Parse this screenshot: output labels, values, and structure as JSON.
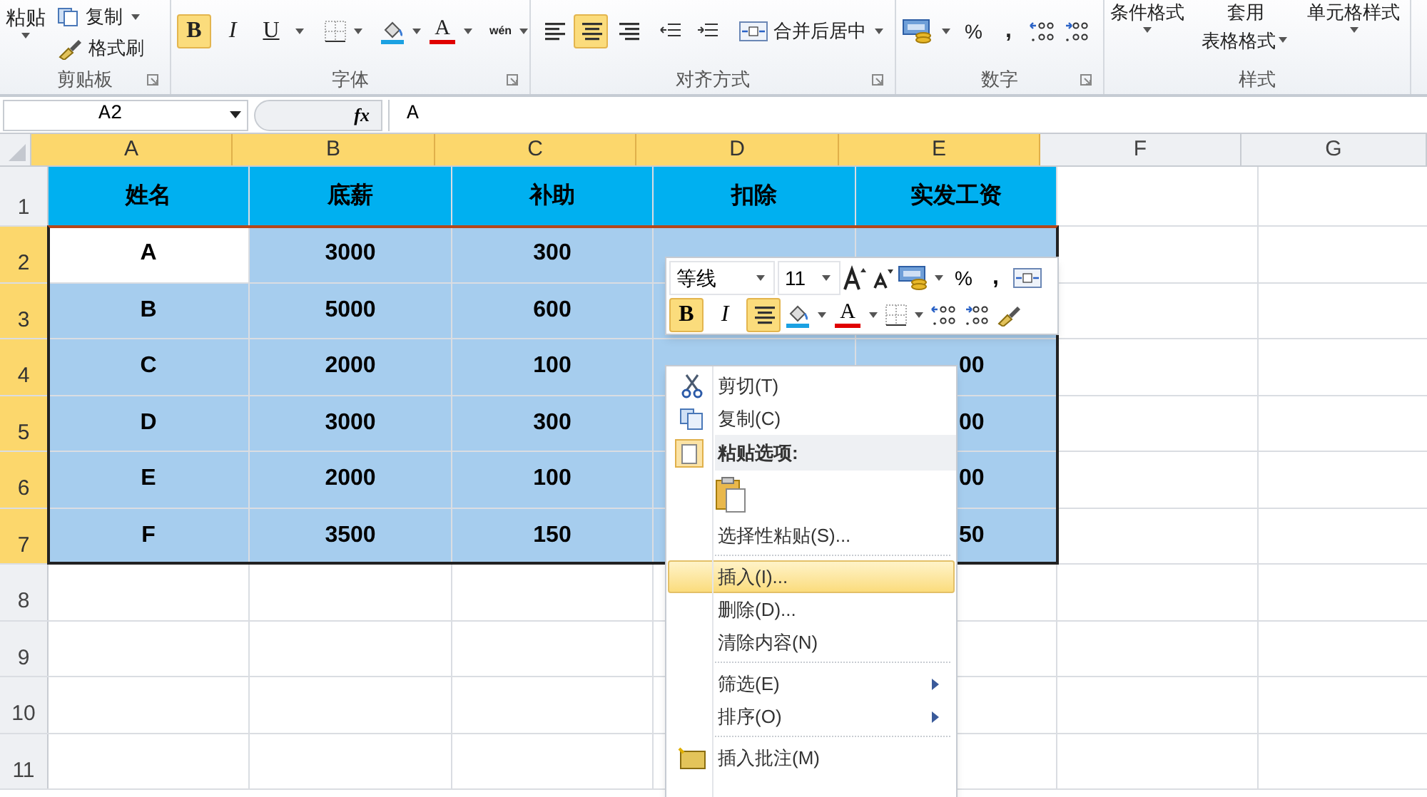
{
  "ribbon": {
    "clipboard": {
      "label": "剪贴板",
      "paste": "粘贴",
      "copy": "复制",
      "format_painter": "格式刷"
    },
    "font": {
      "label": "字体",
      "bold": {
        "label": "B",
        "selected": true
      },
      "italic": {
        "label": "I",
        "selected": false
      },
      "underline": {
        "label": "U",
        "selected": false
      },
      "font_color": "A",
      "phonetic": "wén"
    },
    "alignment": {
      "label": "对齐方式",
      "align": [
        {
          "selected": false
        },
        {
          "selected": true
        },
        {
          "selected": false
        }
      ],
      "merge": "合并后居中"
    },
    "number": {
      "label": "数字",
      "percent": "%",
      "comma": ","
    },
    "styles": {
      "label": "样式",
      "conditional": "条件格式",
      "table_line1": "套用",
      "table_line2": "表格格式",
      "cell_styles": "单元格样式"
    }
  },
  "formula_bar": {
    "name_box": "A2",
    "fx": "fx",
    "value": "A"
  },
  "sheet": {
    "columns": [
      {
        "label": "A",
        "selected": true
      },
      {
        "label": "B",
        "selected": true
      },
      {
        "label": "C",
        "selected": true
      },
      {
        "label": "D",
        "selected": true
      },
      {
        "label": "E",
        "selected": true
      },
      {
        "label": "F",
        "selected": false
      },
      {
        "label": "G",
        "selected": false
      }
    ],
    "rows": [
      {
        "number": "1",
        "selected": false,
        "header": true,
        "cells": [
          "姓名",
          "底薪",
          "补助",
          "扣除",
          "实发工资"
        ]
      },
      {
        "number": "2",
        "selected": true,
        "first_cell_active": true,
        "cells": [
          "A",
          "3000",
          "300"
        ]
      },
      {
        "number": "3",
        "selected": true,
        "cells": [
          "B",
          "5000",
          "600"
        ]
      },
      {
        "number": "4",
        "selected": true,
        "cells": [
          "C",
          "2000",
          "100"
        ],
        "e_tail": "00"
      },
      {
        "number": "5",
        "selected": true,
        "cells": [
          "D",
          "3000",
          "300"
        ],
        "e_tail": "00"
      },
      {
        "number": "6",
        "selected": true,
        "cells": [
          "E",
          "2000",
          "100"
        ],
        "e_tail": "00"
      },
      {
        "number": "7",
        "selected": true,
        "cells": [
          "F",
          "3500",
          "150"
        ],
        "e_tail": "50"
      },
      {
        "number": "8",
        "selected": false,
        "cells": []
      },
      {
        "number": "9",
        "selected": false,
        "cells": []
      },
      {
        "number": "10",
        "selected": false,
        "cells": []
      },
      {
        "number": "11",
        "selected": false,
        "cells": []
      }
    ]
  },
  "mini_toolbar": {
    "font": "等线",
    "size": "11",
    "percent": "%",
    "comma": ",",
    "bold": {
      "label": "B",
      "selected": true
    },
    "italic": {
      "label": "I",
      "selected": false
    },
    "center": {
      "selected": true
    },
    "font_color": "A"
  },
  "context_menu": [
    {
      "kind": "cut",
      "label": "剪切(T)",
      "selected": false
    },
    {
      "kind": "copy",
      "label": "复制(C)",
      "selected": false
    },
    {
      "kind": "header",
      "label": "粘贴选项:"
    },
    {
      "kind": "paste_option"
    },
    {
      "kind": "item",
      "label": "选择性粘贴(S)...",
      "selected": false
    },
    {
      "kind": "item",
      "label": "插入(I)...",
      "selected": true,
      "separator_before": true
    },
    {
      "kind": "item",
      "label": "删除(D)...",
      "selected": false
    },
    {
      "kind": "item",
      "label": "清除内容(N)",
      "selected": false
    },
    {
      "kind": "item",
      "label": "筛选(E)",
      "selected": false,
      "submenu": true,
      "separator_before": true
    },
    {
      "kind": "item",
      "label": "排序(O)",
      "selected": false,
      "submenu": true
    },
    {
      "kind": "comment",
      "label": "插入批注(M)",
      "selected": false,
      "separator_before": true
    }
  ]
}
